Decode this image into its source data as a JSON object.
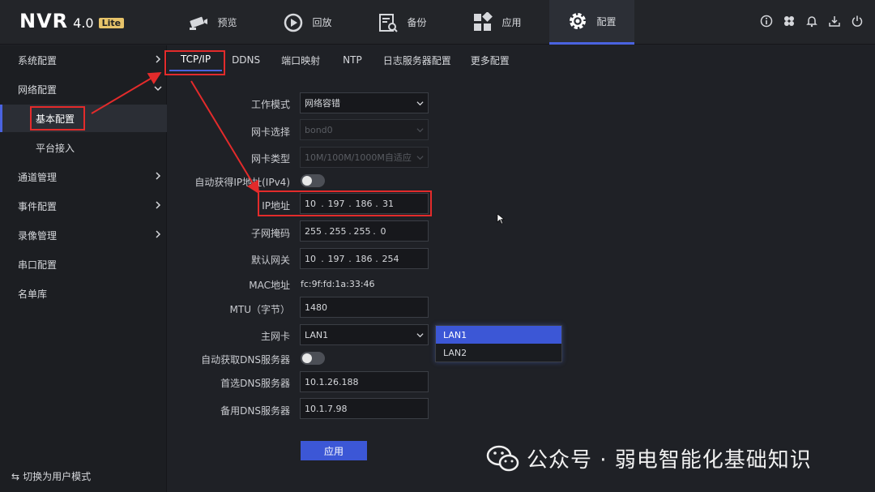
{
  "logo": {
    "name": "NVR",
    "version": "4.0",
    "edition": "Lite"
  },
  "nav": [
    {
      "label": "预览",
      "icon": "camera-icon"
    },
    {
      "label": "回放",
      "icon": "playback-icon"
    },
    {
      "label": "备份",
      "icon": "backup-search-icon"
    },
    {
      "label": "应用",
      "icon": "apps-grid-icon"
    },
    {
      "label": "配置",
      "icon": "gear-icon",
      "active": true
    }
  ],
  "top_icons": [
    "info-icon",
    "fan-icon",
    "bell-icon",
    "download-icon",
    "power-icon"
  ],
  "sidebar": {
    "items": [
      {
        "label": "系统配置"
      },
      {
        "label": "网络配置"
      },
      {
        "label": "基本配置"
      },
      {
        "label": "平台接入"
      },
      {
        "label": "通道管理"
      },
      {
        "label": "事件配置"
      },
      {
        "label": "录像管理"
      },
      {
        "label": "串口配置"
      },
      {
        "label": "名单库"
      }
    ],
    "switch_mode": "切换为用户模式"
  },
  "subtabs": [
    "TCP/IP",
    "DDNS",
    "端口映射",
    "NTP",
    "日志服务器配置",
    "更多配置"
  ],
  "form": {
    "work_mode": {
      "label": "工作模式",
      "value": "网络容错"
    },
    "nic_select": {
      "label": "网卡选择",
      "value": "bond0"
    },
    "nic_type": {
      "label": "网卡类型",
      "value": "10M/100M/1000M自适应"
    },
    "dhcp": {
      "label": "自动获得IP地址(IPv4)",
      "on": false
    },
    "ip": {
      "label": "IP地址",
      "parts": [
        "10",
        "197",
        "186",
        "31"
      ]
    },
    "mask": {
      "label": "子网掩码",
      "parts": [
        "255",
        "255",
        "255",
        "0"
      ]
    },
    "gateway": {
      "label": "默认网关",
      "parts": [
        "10",
        "197",
        "186",
        "254"
      ]
    },
    "mac": {
      "label": "MAC地址",
      "value": "fc:9f:fd:1a:33:46"
    },
    "mtu": {
      "label": "MTU（字节）",
      "value": "1480"
    },
    "main_nic": {
      "label": "主网卡",
      "value": "LAN1",
      "options": [
        "LAN1",
        "LAN2"
      ]
    },
    "auto_dns": {
      "label": "自动获取DNS服务器",
      "on": false
    },
    "dns1": {
      "label": "首选DNS服务器",
      "value": "10.1.26.188"
    },
    "dns2": {
      "label": "备用DNS服务器",
      "value": "10.1.7.98"
    },
    "apply": "应用"
  },
  "watermark": "公众号 · 弱电智能化基础知识",
  "colors": {
    "accent": "#3c57d6",
    "annotation": "#e32b2b"
  }
}
